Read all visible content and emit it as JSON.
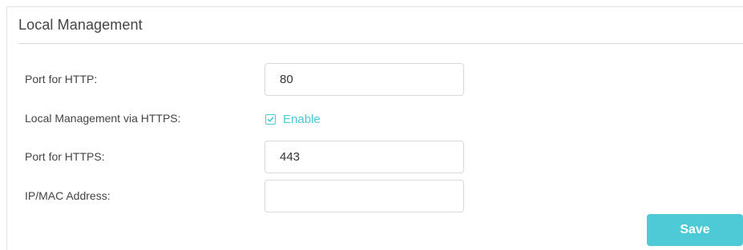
{
  "section": {
    "title": "Local Management"
  },
  "fields": {
    "http_port": {
      "label": "Port for HTTP:",
      "value": "80"
    },
    "https_management": {
      "label": "Local Management via HTTPS:",
      "checkbox_label": "Enable",
      "checked": true
    },
    "https_port": {
      "label": "Port for HTTPS:",
      "value": "443"
    },
    "ip_mac": {
      "label": "IP/MAC Address:",
      "value": ""
    }
  },
  "actions": {
    "save_label": "Save"
  },
  "colors": {
    "accent": "#4ec9d6",
    "text": "#444444",
    "border": "#d9d9d9"
  },
  "icons": {
    "checkbox": "checkmark-icon"
  }
}
